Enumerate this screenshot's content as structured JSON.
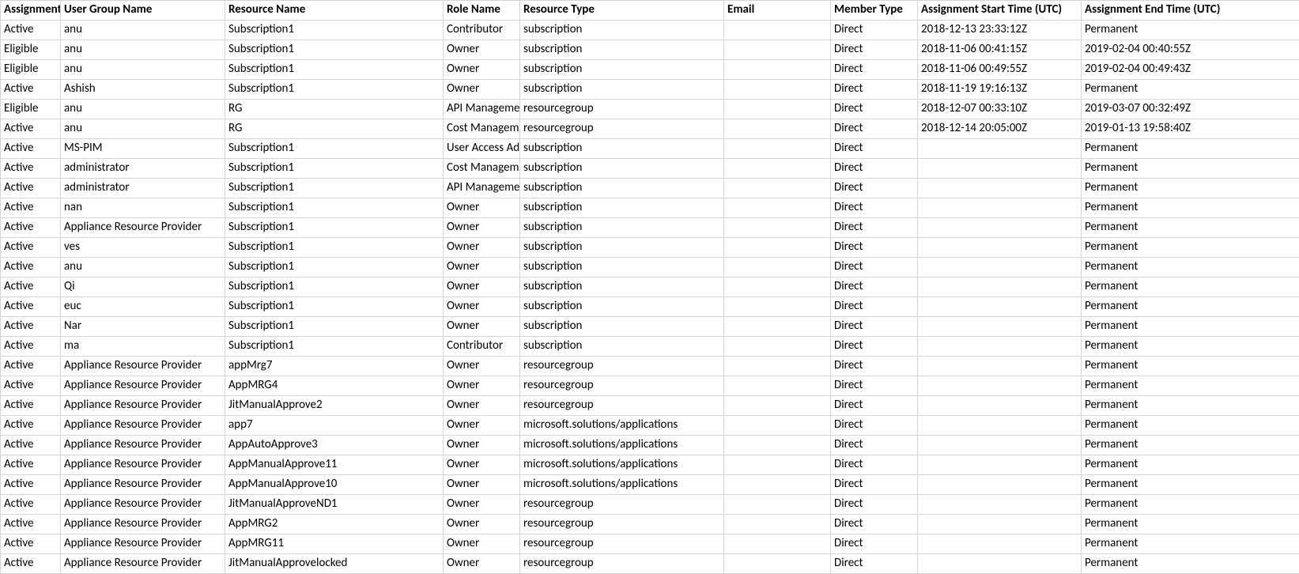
{
  "headers": [
    "Assignment",
    "User Group Name",
    "Resource Name",
    "Role Name",
    "Resource Type",
    "Email",
    "Member Type",
    "Assignment Start Time (UTC)",
    "Assignment End Time (UTC)"
  ],
  "rows": [
    {
      "state": "Active",
      "user": "anu",
      "resource": "Subscription1",
      "role": "Contributor",
      "rtype": "subscription",
      "email": "",
      "mtype": "Direct",
      "start": "2018-12-13 23:33:12Z",
      "end": "Permanent"
    },
    {
      "state": "Eligible",
      "user": "anu",
      "resource": "Subscription1",
      "role": "Owner",
      "rtype": "subscription",
      "email": "",
      "mtype": "Direct",
      "start": "2018-11-06 00:41:15Z",
      "end": "2019-02-04 00:40:55Z"
    },
    {
      "state": "Eligible",
      "user": "anu",
      "resource": "Subscription1",
      "role": "Owner",
      "rtype": "subscription",
      "email": "",
      "mtype": "Direct",
      "start": "2018-11-06 00:49:55Z",
      "end": "2019-02-04 00:49:43Z"
    },
    {
      "state": "Active",
      "user": "Ashish",
      "resource": "Subscription1",
      "role": "Owner",
      "rtype": "subscription",
      "email": "",
      "mtype": "Direct",
      "start": "2018-11-19 19:16:13Z",
      "end": "Permanent"
    },
    {
      "state": "Eligible",
      "user": "anu",
      "resource": "RG",
      "role": "API Management",
      "rtype": "resourcegroup",
      "email": "",
      "mtype": "Direct",
      "start": "2018-12-07 00:33:10Z",
      "end": "2019-03-07 00:32:49Z"
    },
    {
      "state": "Active",
      "user": "anu",
      "resource": "RG",
      "role": "Cost Management",
      "rtype": "resourcegroup",
      "email": "",
      "mtype": "Direct",
      "start": "2018-12-14 20:05:00Z",
      "end": "2019-01-13 19:58:40Z"
    },
    {
      "state": "Active",
      "user": "MS-PIM",
      "resource": "Subscription1",
      "role": "User Access Administrator",
      "rtype": "subscription",
      "email": "",
      "mtype": "Direct",
      "start": "",
      "end": "Permanent"
    },
    {
      "state": "Active",
      "user": "administrator",
      "resource": "Subscription1",
      "role": "Cost Management",
      "rtype": "subscription",
      "email": "",
      "mtype": "Direct",
      "start": "",
      "end": "Permanent"
    },
    {
      "state": "Active",
      "user": "administrator",
      "resource": "Subscription1",
      "role": "API Management",
      "rtype": "subscription",
      "email": "",
      "mtype": "Direct",
      "start": "",
      "end": "Permanent"
    },
    {
      "state": "Active",
      "user": "nan",
      "resource": "Subscription1",
      "role": "Owner",
      "rtype": "subscription",
      "email": "",
      "mtype": "Direct",
      "start": "",
      "end": "Permanent"
    },
    {
      "state": "Active",
      "user": "Appliance Resource Provider",
      "resource": "Subscription1",
      "role": "Owner",
      "rtype": "subscription",
      "email": "",
      "mtype": "Direct",
      "start": "",
      "end": "Permanent"
    },
    {
      "state": "Active",
      "user": "ves",
      "resource": "Subscription1",
      "role": "Owner",
      "rtype": "subscription",
      "email": "",
      "mtype": "Direct",
      "start": "",
      "end": "Permanent"
    },
    {
      "state": "Active",
      "user": "anu",
      "resource": "Subscription1",
      "role": "Owner",
      "rtype": "subscription",
      "email": "",
      "mtype": "Direct",
      "start": "",
      "end": "Permanent"
    },
    {
      "state": "Active",
      "user": "Qi",
      "resource": "Subscription1",
      "role": "Owner",
      "rtype": "subscription",
      "email": "",
      "mtype": "Direct",
      "start": "",
      "end": "Permanent"
    },
    {
      "state": "Active",
      "user": "euc",
      "resource": "Subscription1",
      "role": "Owner",
      "rtype": "subscription",
      "email": "",
      "mtype": "Direct",
      "start": "",
      "end": "Permanent"
    },
    {
      "state": "Active",
      "user": "Nar",
      "resource": "Subscription1",
      "role": "Owner",
      "rtype": "subscription",
      "email": "",
      "mtype": "Direct",
      "start": "",
      "end": "Permanent"
    },
    {
      "state": "Active",
      "user": "ma",
      "resource": "Subscription1",
      "role": "Contributor",
      "rtype": "subscription",
      "email": "",
      "mtype": "Direct",
      "start": "",
      "end": "Permanent"
    },
    {
      "state": "Active",
      "user": "Appliance Resource Provider",
      "resource": "appMrg7",
      "role": "Owner",
      "rtype": "resourcegroup",
      "email": "",
      "mtype": "Direct",
      "start": "",
      "end": "Permanent"
    },
    {
      "state": "Active",
      "user": "Appliance Resource Provider",
      "resource": "AppMRG4",
      "role": "Owner",
      "rtype": "resourcegroup",
      "email": "",
      "mtype": "Direct",
      "start": "",
      "end": "Permanent"
    },
    {
      "state": "Active",
      "user": "Appliance Resource Provider",
      "resource": "JitManualApprove2",
      "role": "Owner",
      "rtype": "resourcegroup",
      "email": "",
      "mtype": "Direct",
      "start": "",
      "end": "Permanent"
    },
    {
      "state": "Active",
      "user": "Appliance Resource Provider",
      "resource": "app7",
      "role": "Owner",
      "rtype": "microsoft.solutions/applications",
      "email": "",
      "mtype": "Direct",
      "start": "",
      "end": "Permanent"
    },
    {
      "state": "Active",
      "user": "Appliance Resource Provider",
      "resource": "AppAutoApprove3",
      "role": "Owner",
      "rtype": "microsoft.solutions/applications",
      "email": "",
      "mtype": "Direct",
      "start": "",
      "end": "Permanent"
    },
    {
      "state": "Active",
      "user": "Appliance Resource Provider",
      "resource": "AppManualApprove11",
      "role": "Owner",
      "rtype": "microsoft.solutions/applications",
      "email": "",
      "mtype": "Direct",
      "start": "",
      "end": "Permanent"
    },
    {
      "state": "Active",
      "user": "Appliance Resource Provider",
      "resource": "AppManualApprove10",
      "role": "Owner",
      "rtype": "microsoft.solutions/applications",
      "email": "",
      "mtype": "Direct",
      "start": "",
      "end": "Permanent"
    },
    {
      "state": "Active",
      "user": "Appliance Resource Provider",
      "resource": "JitManualApproveND1",
      "role": "Owner",
      "rtype": "resourcegroup",
      "email": "",
      "mtype": "Direct",
      "start": "",
      "end": "Permanent"
    },
    {
      "state": "Active",
      "user": "Appliance Resource Provider",
      "resource": "AppMRG2",
      "role": "Owner",
      "rtype": "resourcegroup",
      "email": "",
      "mtype": "Direct",
      "start": "",
      "end": "Permanent"
    },
    {
      "state": "Active",
      "user": "Appliance Resource Provider",
      "resource": "AppMRG11",
      "role": "Owner",
      "rtype": "resourcegroup",
      "email": "",
      "mtype": "Direct",
      "start": "",
      "end": "Permanent"
    },
    {
      "state": "Active",
      "user": "Appliance Resource Provider",
      "resource": "JitManualApprovelocked",
      "role": "Owner",
      "rtype": "resourcegroup",
      "email": "",
      "mtype": "Direct",
      "start": "",
      "end": "Permanent"
    }
  ]
}
